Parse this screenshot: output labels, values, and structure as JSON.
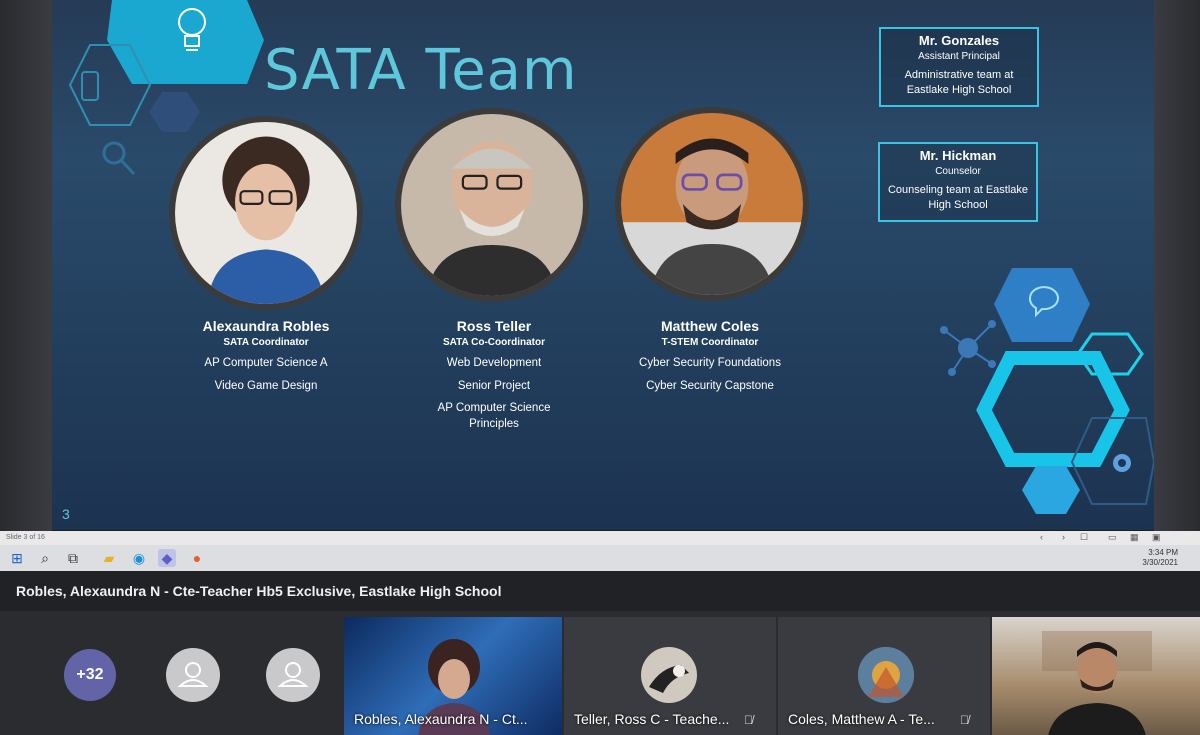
{
  "slide": {
    "title": "SATA Team",
    "number": "3",
    "people": [
      {
        "name": "Alexaundra Robles",
        "role": "SATA Coordinator",
        "courses": [
          "AP Computer Science A",
          "Video Game Design"
        ]
      },
      {
        "name": "Ross Teller",
        "role": "SATA Co-Coordinator",
        "courses": [
          "Web Development",
          "Senior Project",
          "AP Computer Science Principles"
        ]
      },
      {
        "name": "Matthew Coles",
        "role": "T-STEM Coordinator",
        "courses": [
          "Cyber Security Foundations",
          "Cyber Security Capstone"
        ]
      }
    ],
    "admins": [
      {
        "name": "Mr. Gonzales",
        "role": "Assistant Principal",
        "desc": "Administrative team at Eastlake High School"
      },
      {
        "name": "Mr. Hickman",
        "role": "Counselor",
        "desc": "Counseling team at Eastlake High School"
      }
    ],
    "colors": {
      "accent": "#5fc7dc",
      "background": "#253b56",
      "box_border": "#39c4e4"
    }
  },
  "ppt_status": {
    "slide_of": "Slide 3 of 16"
  },
  "taskbar": {
    "icons": [
      "windows-icon",
      "search-icon",
      "task-view-icon",
      "file-explorer-icon",
      "edge-icon",
      "teams-icon",
      "firefox-icon"
    ],
    "time": "3:34 PM",
    "date": "3/30/2021"
  },
  "meeting": {
    "presenter": "Robles, Alexaundra N - Cte-Teacher Hb5 Exclusive, Eastlake High School",
    "overflow_count": "+32",
    "tiles": [
      {
        "label": "Robles, Alexaundra N - Ct..."
      },
      {
        "label": "Teller, Ross C - Teache...",
        "muted": true
      },
      {
        "label": "Coles, Matthew A - Te...",
        "muted": true
      }
    ]
  }
}
